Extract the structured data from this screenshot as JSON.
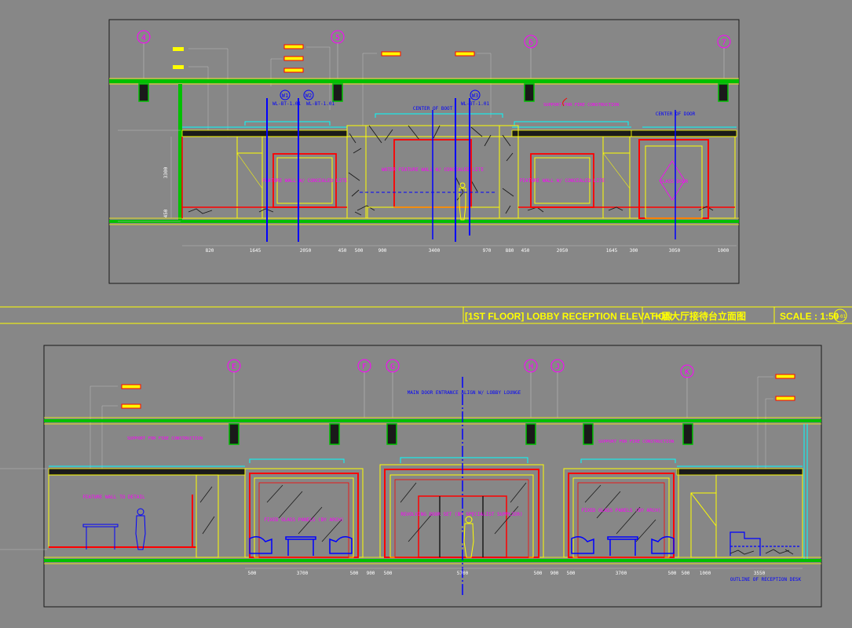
{
  "title_bar": {
    "title": "[1ST FLOOR] LOBBY RECEPTION ELEVATION",
    "title_cn": "一层大厅接待台立面图",
    "scale": "SCALE : 1:50",
    "sheet": "8-01"
  },
  "upper": {
    "grid": [
      "4",
      "5",
      "6",
      "7"
    ],
    "notes": {
      "wall_tag_top": "W1",
      "wall_tag_mid": "W2",
      "wall_tag_right": "W3",
      "ref_a": "WL-BT-1.01",
      "ref_b": "WL-BT-1.01",
      "ref_c": "WL-BT-1.01",
      "center_left": "CENTER OF BOOT",
      "center_right": "CENTER OF DOOR",
      "magenta_note": "SUPPORT FOR FIRE CONSTRUCTION"
    },
    "labels": {
      "feature_left": "FEATURE WALL W/ CONCEALED LITE",
      "water": "WATER FEATURE WALL W/ CONCEALED LITE",
      "feature_right": "FEATURE WALL W/ CONCEALED LITE",
      "door": "GLASS DOOR"
    },
    "dims": [
      "820",
      "1645",
      "2050",
      "450",
      "500",
      "900",
      "3400",
      "970",
      "880",
      "450",
      "2050",
      "1645",
      "300",
      "3050",
      "1000"
    ],
    "heights": [
      "3300",
      "450"
    ]
  },
  "lower": {
    "grid": [
      "E",
      "F",
      "G",
      "H",
      "J",
      "K"
    ],
    "main_note": "MAIN DOOR ENTRANCE ALIGN W/ LOBBY LOUNGE",
    "magenta_note_left": "SUPPORT FOR FIRE CONSTRUCTION",
    "magenta_note_right": "SUPPORT FOR FIRE CONSTRUCTION",
    "labels": {
      "feature_wall": "FEATURE WALL TO DETAIL",
      "glass_left": "FIXED GLASS PANELS (BY ARCH)",
      "door": "REVOLVING DOOR SET (BY SPECIALIST SUPPLIER)",
      "glass_right": "FIXED GLASS PANELS (BY ARCH)",
      "desk": "OUTLINE OF RECEPTION DESK"
    },
    "dims": [
      "500",
      "3700",
      "500",
      "900",
      "500",
      "5700",
      "500",
      "900",
      "500",
      "3700",
      "500",
      "500",
      "1000",
      "3550"
    ]
  },
  "colors": {
    "background": "#878787",
    "frame": "#1a1a1a",
    "floor": "#00c000",
    "wall": "#ffff00",
    "accent": "#ff0000",
    "axis": "#0000ff",
    "note": "#ff00ff",
    "text": "#ffffff",
    "trim": "#00ffff"
  }
}
